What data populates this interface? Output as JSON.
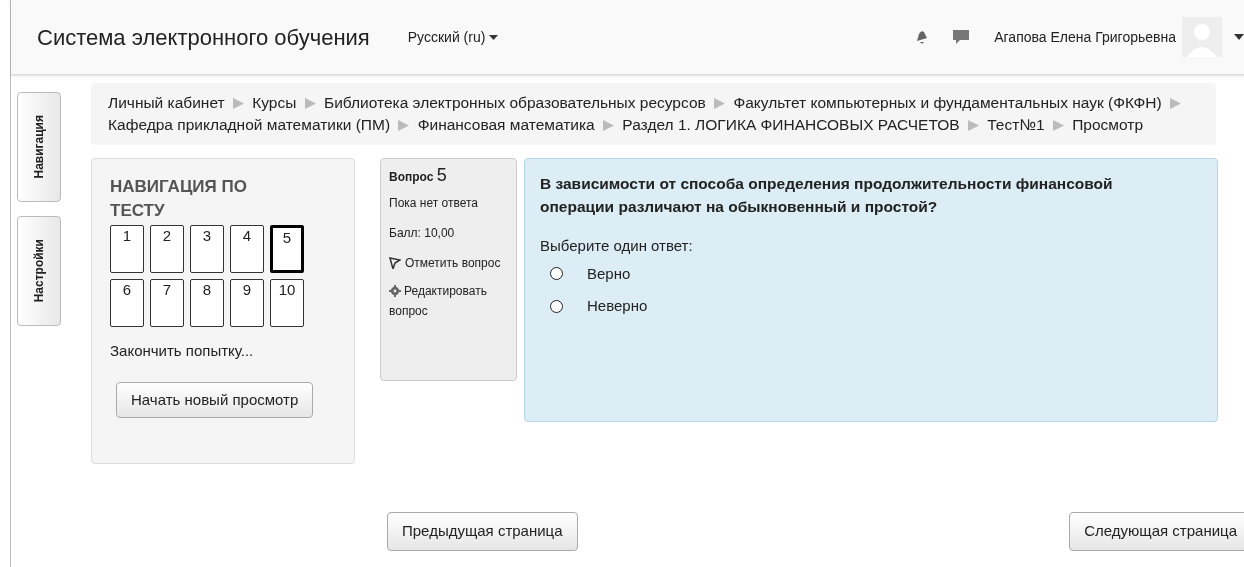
{
  "header": {
    "site_title": "Система электронного обучения",
    "language": "Русский (ru)",
    "user_name": "Агапова Елена Григорьевна"
  },
  "side_tabs": [
    {
      "label": "Навигация"
    },
    {
      "label": "Настройки"
    }
  ],
  "breadcrumb": [
    "Личный кабинет",
    "Курсы",
    "Библиотека электронных образовательных ресурсов",
    "Факультет компьютерных и фундаментальных наук (ФКФН)",
    "Кафедра прикладной математики (ПМ)",
    "Финансовая математика",
    "Раздел 1. ЛОГИКА ФИНАНСОВЫХ РАСЧЕТОВ",
    "Тест№1",
    "Просмотр"
  ],
  "quiz_nav": {
    "title": "НАВИГАЦИЯ ПО ТЕСТУ",
    "questions": [
      {
        "label": "1",
        "selected": false
      },
      {
        "label": "2",
        "selected": false
      },
      {
        "label": "3",
        "selected": false
      },
      {
        "label": "4",
        "selected": false
      },
      {
        "label": "5",
        "selected": true
      },
      {
        "label": "6",
        "selected": false
      },
      {
        "label": "7",
        "selected": false
      },
      {
        "label": "8",
        "selected": false
      },
      {
        "label": "9",
        "selected": false
      },
      {
        "label": "10",
        "selected": false
      }
    ],
    "finish_link": "Закончить попытку...",
    "restart_button": "Начать новый просмотр"
  },
  "question_info": {
    "label": "Вопрос",
    "number": "5",
    "state": "Пока нет ответа",
    "grade": "Балл: 10,00",
    "flag_link": "Отметить вопрос",
    "edit_link": "Редактировать вопрос"
  },
  "question": {
    "text": "В зависимости от способа определения продолжительности финансовой операции различают на обыкновенный и простой?",
    "prompt": "Выберите один ответ:",
    "options": [
      {
        "label": "Верно",
        "selected": false
      },
      {
        "label": "Неверно",
        "selected": false
      }
    ]
  },
  "footer_buttons": {
    "previous": "Предыдущая страница",
    "next": "Следующая страница"
  }
}
